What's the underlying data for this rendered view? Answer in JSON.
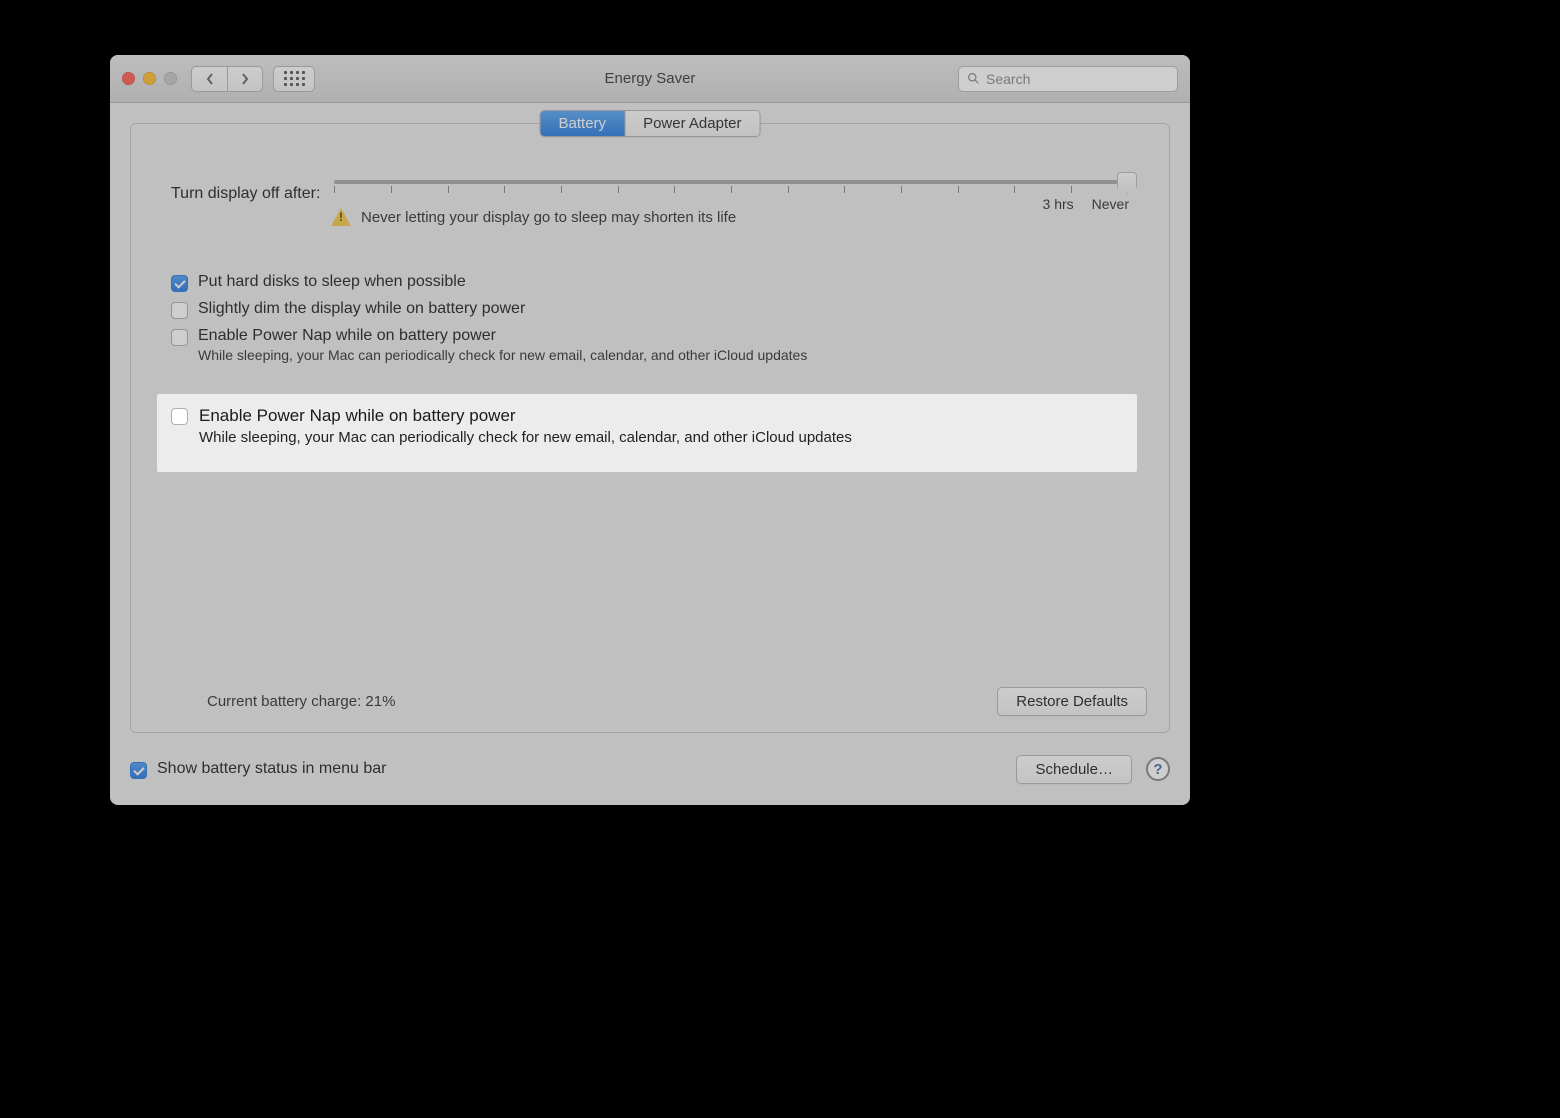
{
  "window": {
    "title": "Energy Saver"
  },
  "search": {
    "placeholder": "Search"
  },
  "tabs": {
    "battery": "Battery",
    "power_adapter": "Power Adapter"
  },
  "slider": {
    "label": "Turn display off after:",
    "mark_3hrs": "3 hrs",
    "mark_never": "Never",
    "warning": "Never letting your display go to sleep may shorten its life"
  },
  "checks": {
    "hard_disks": "Put hard disks to sleep when possible",
    "dim_display": "Slightly dim the display while on battery power",
    "power_nap": "Enable Power Nap while on battery power",
    "power_nap_sub": "While sleeping, your Mac can periodically check for new email, calendar, and other iCloud updates"
  },
  "status": {
    "battery_charge": "Current battery charge: 21%"
  },
  "buttons": {
    "restore_defaults": "Restore Defaults",
    "schedule": "Schedule…"
  },
  "footer": {
    "show_battery_status": "Show battery status in menu bar"
  }
}
